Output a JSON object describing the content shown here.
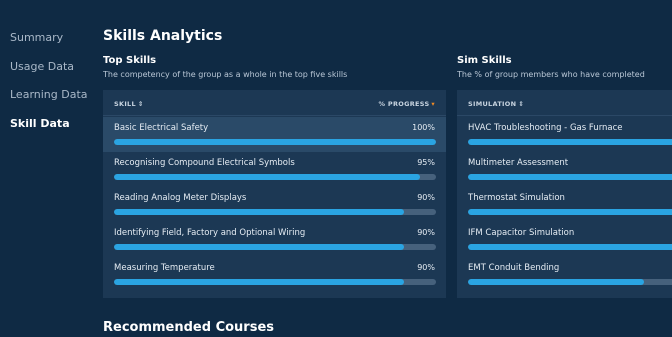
{
  "sidebar": {
    "items": [
      {
        "label": "Summary",
        "active": false
      },
      {
        "label": "Usage Data",
        "active": false
      },
      {
        "label": "Learning Data",
        "active": false
      },
      {
        "label": "Skill Data",
        "active": true
      }
    ]
  },
  "page": {
    "title": "Skills Analytics",
    "footer_heading": "Recommended Courses"
  },
  "top_skills": {
    "title": "Top Skills",
    "subtitle": "The competency of the group as a whole in the top five skills",
    "col_skill": "SKILL",
    "col_progress": "% PROGRESS",
    "rows": [
      {
        "label": "Basic Electrical Safety",
        "pct": "100%",
        "value": 1.0
      },
      {
        "label": "Recognising Compound Electrical Symbols",
        "pct": "95%",
        "value": 0.95
      },
      {
        "label": "Reading Analog Meter Displays",
        "pct": "90%",
        "value": 0.9
      },
      {
        "label": "Identifying Field, Factory and Optional Wiring",
        "pct": "90%",
        "value": 0.9
      },
      {
        "label": "Measuring Temperature",
        "pct": "90%",
        "value": 0.9
      }
    ]
  },
  "sim_skills": {
    "title": "Sim Skills",
    "subtitle": "The % of group members who have completed",
    "col_sim": "SIMULATION",
    "rows": [
      {
        "label": "HVAC Troubleshooting - Gas Furnace",
        "value": 1.0
      },
      {
        "label": "Multimeter Assessment",
        "value": 1.0
      },
      {
        "label": "Thermostat Simulation",
        "value": 1.0
      },
      {
        "label": "IFM Capacitor Simulation",
        "value": 1.0
      },
      {
        "label": "EMT Conduit Bending",
        "value": 0.8
      }
    ]
  },
  "icons": {
    "sort": "sort-icon",
    "sort_active": "sort-desc-icon"
  },
  "colors": {
    "background": "#0f2a44",
    "panel": "#1c3854",
    "bar_fill": "#2aa4e2",
    "bar_track": "#46617c",
    "sort_accent": "#f08a24"
  }
}
